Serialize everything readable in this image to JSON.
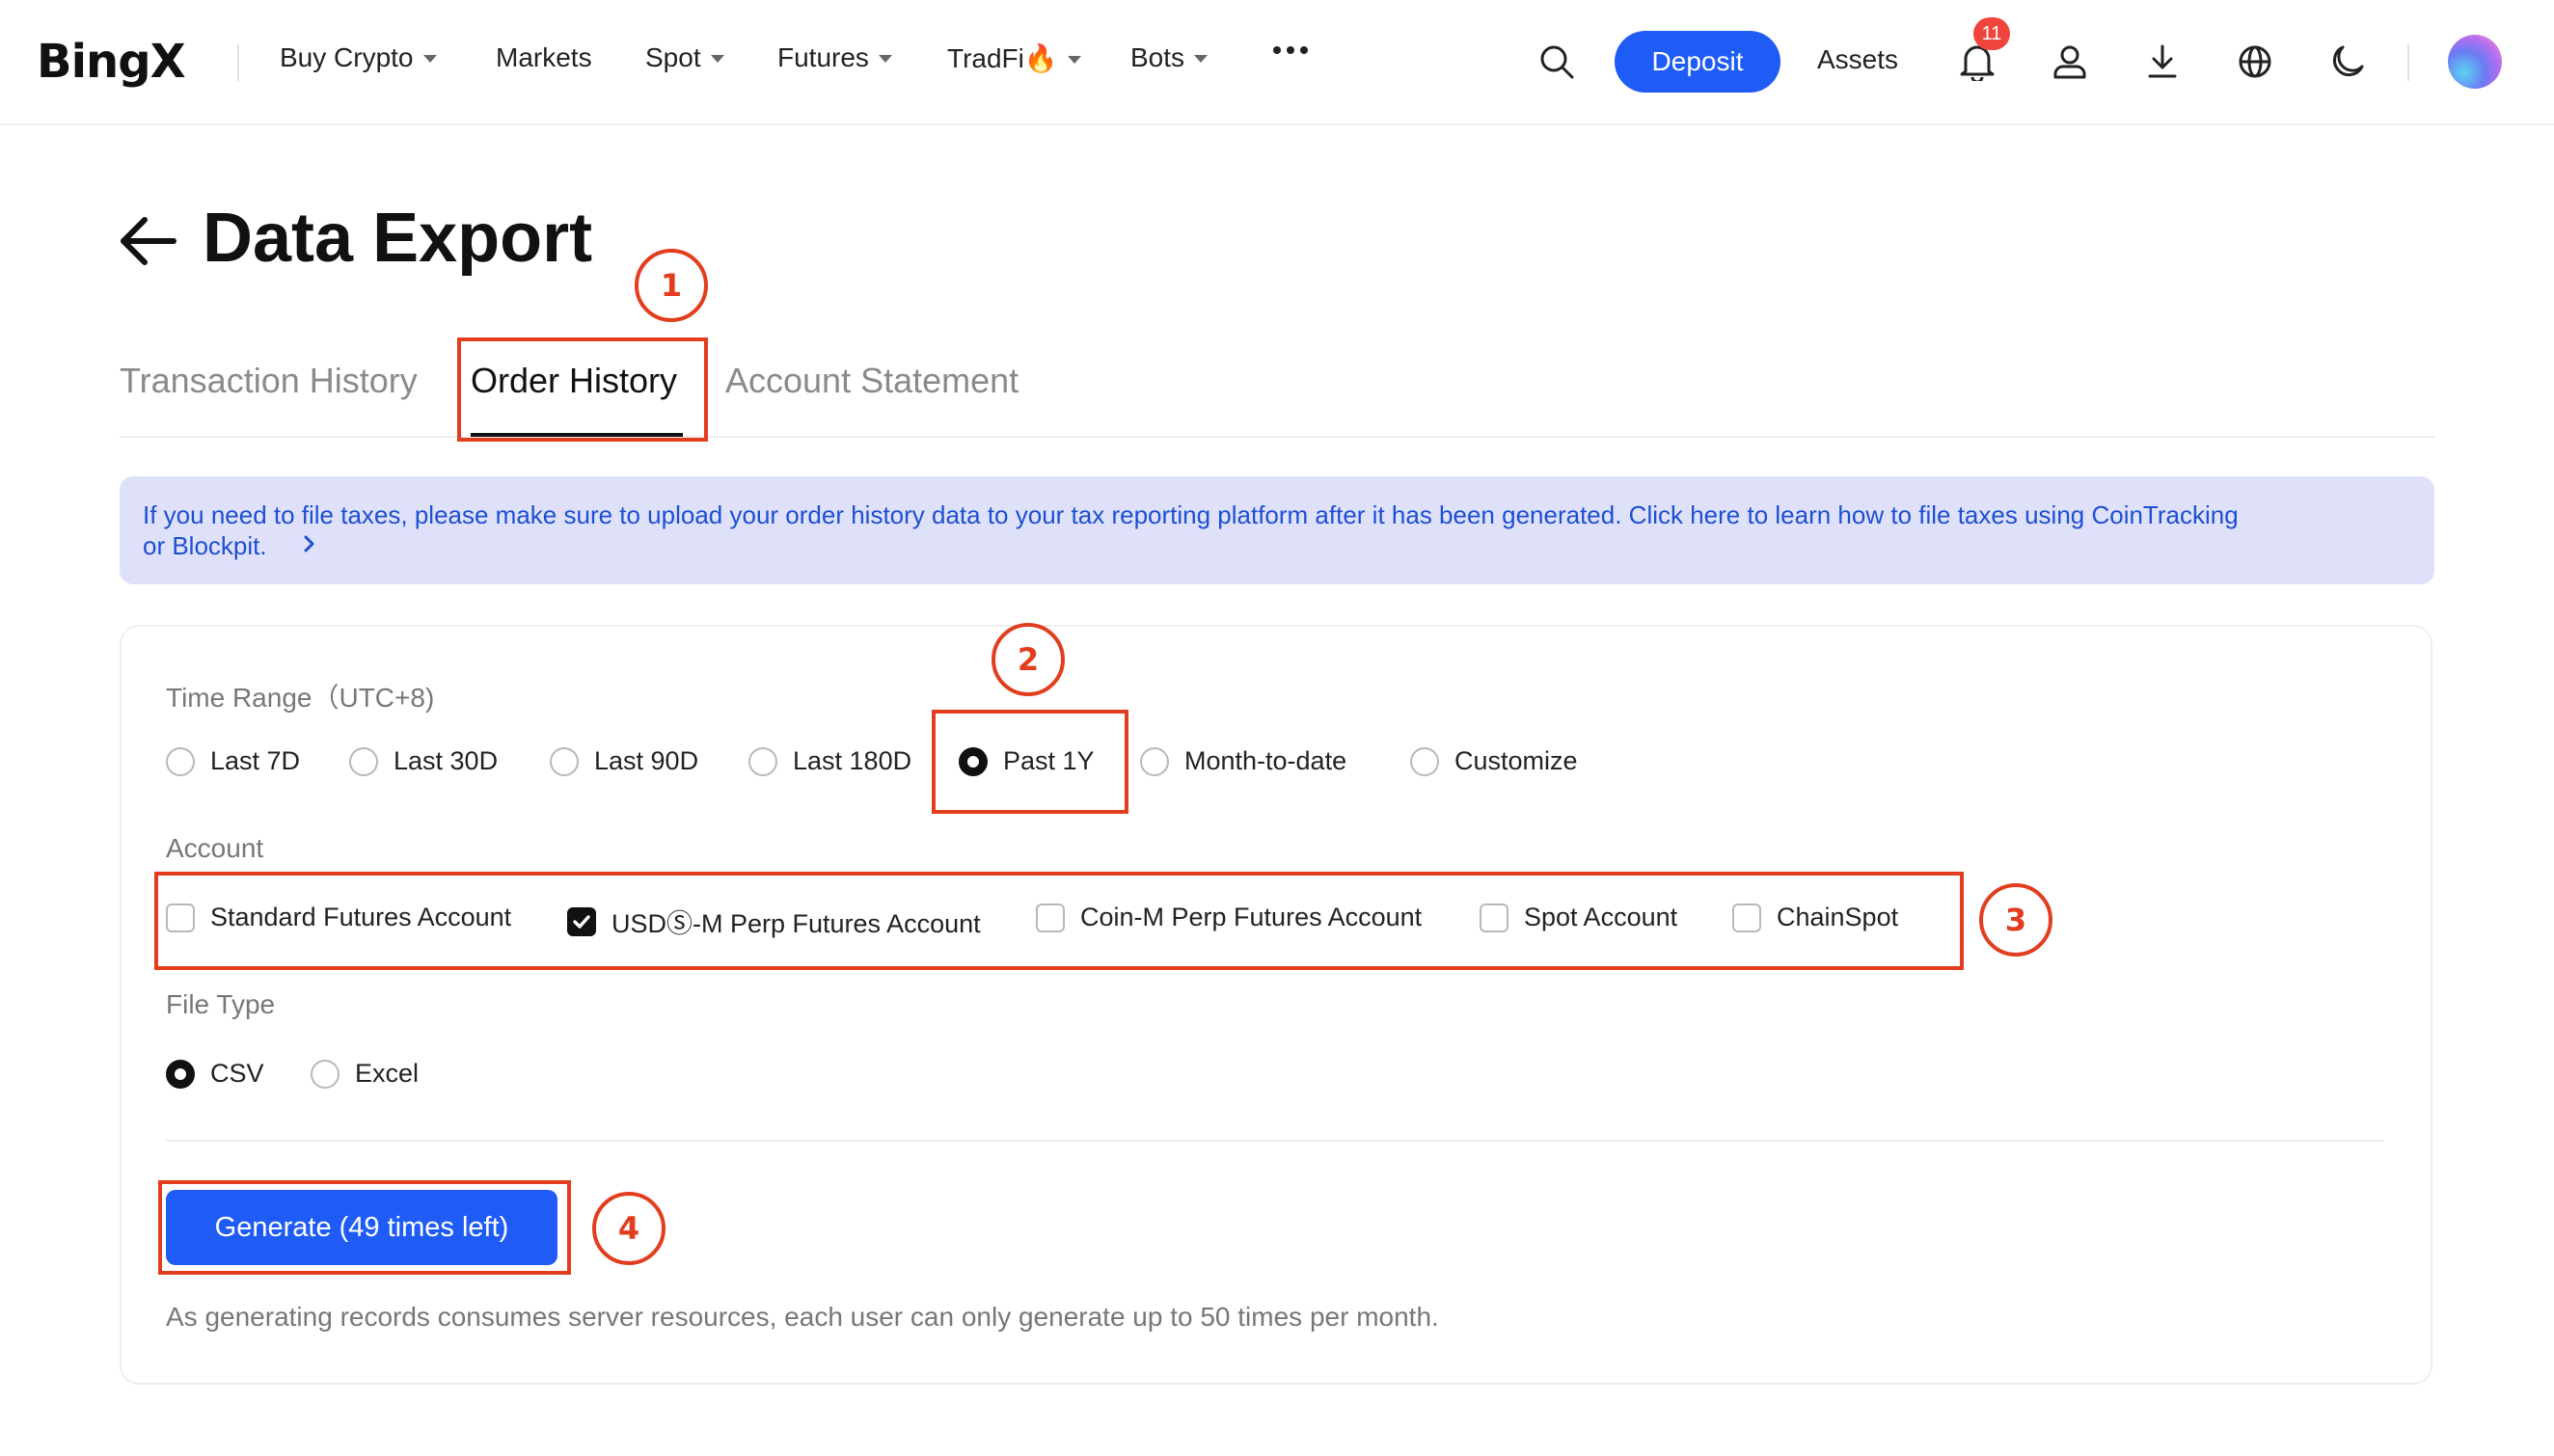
{
  "nav": {
    "logo": "BingX",
    "items": [
      {
        "label": "Buy Crypto",
        "caret": true
      },
      {
        "label": "Markets",
        "caret": false
      },
      {
        "label": "Spot",
        "caret": true
      },
      {
        "label": "Futures",
        "caret": true
      },
      {
        "label": "TradFi🔥",
        "caret": true
      },
      {
        "label": "Bots",
        "caret": true
      }
    ],
    "more_icon": "more-dots-icon",
    "deposit": "Deposit",
    "assets": "Assets",
    "notification_count": "11",
    "icons": [
      "search-icon",
      "bell-icon",
      "user-icon",
      "download-icon",
      "globe-icon",
      "moon-icon"
    ],
    "accent_color": "#1f5cf5"
  },
  "page": {
    "title": "Data Export",
    "tabs": [
      {
        "label": "Transaction History",
        "active": false
      },
      {
        "label": "Order History",
        "active": true
      },
      {
        "label": "Account Statement",
        "active": false
      }
    ],
    "banner": {
      "text_line1": "If you need to file taxes, please make sure to upload your order history data to your tax reporting platform after it has been generated. Click here to learn how to file taxes using CoinTracking",
      "text_line2": "or Blockpit.",
      "bg_color": "#dfe1fb",
      "text_color": "#1d4fd1"
    }
  },
  "form": {
    "time_range": {
      "label": "Time Range（UTC+8)",
      "options": [
        "Last 7D",
        "Last 30D",
        "Last 90D",
        "Last 180D",
        "Past 1Y",
        "Month-to-date",
        "Customize"
      ],
      "selected": "Past 1Y"
    },
    "account": {
      "label": "Account",
      "options": [
        {
          "label": "Standard Futures Account",
          "checked": false
        },
        {
          "label": "USDⓈ-M Perp Futures Account",
          "checked": true
        },
        {
          "label": "Coin-M Perp Futures Account",
          "checked": false
        },
        {
          "label": "Spot Account",
          "checked": false
        },
        {
          "label": "ChainSpot",
          "checked": false
        }
      ]
    },
    "file_type": {
      "label": "File Type",
      "options": [
        "CSV",
        "Excel"
      ],
      "selected": "CSV"
    },
    "generate_button": "Generate (49 times left)",
    "note": "As generating records consumes server resources, each user can only generate up to 50 times per month."
  },
  "annotations": {
    "steps": [
      "1",
      "2",
      "3",
      "4"
    ],
    "color": "#e23d1e"
  }
}
